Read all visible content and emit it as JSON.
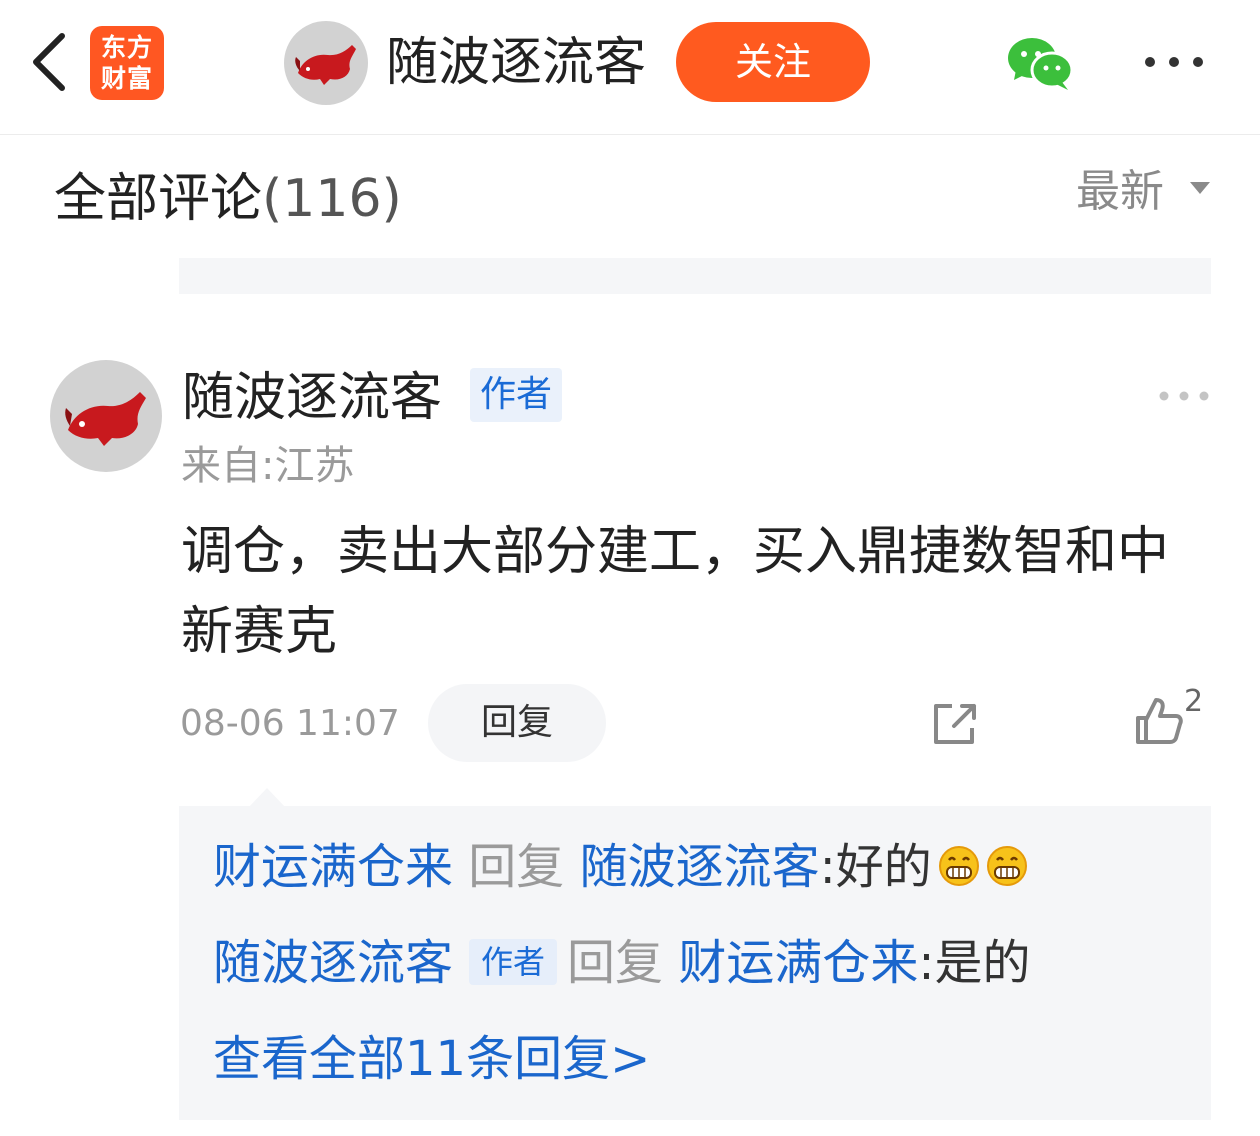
{
  "header": {
    "logo_line1": "东方",
    "logo_line2": "财富",
    "user_name": "随波逐流客",
    "follow_label": "关注"
  },
  "comments_section": {
    "title": "全部评论",
    "count": "(116)",
    "sort_label": "最新"
  },
  "comment": {
    "user_name": "随波逐流客",
    "author_tag": "作者",
    "location": "来自:江苏",
    "content": "调仓，卖出大部分建工，买入鼎捷数智和中新赛克",
    "timestamp": "08-06 11:07",
    "reply_label": "回复",
    "like_count": "2",
    "replies": [
      {
        "from": "财运满仓来",
        "verb": "回复",
        "to": "随波逐流客",
        "sep": ":",
        "text": "好的",
        "emoji": "grin-emoji"
      },
      {
        "from": "随波逐流客",
        "from_tag": "作者",
        "verb": "回复",
        "to": "财运满仓来",
        "sep": ":",
        "text": "是的"
      }
    ],
    "view_all": "查看全部11条回复>"
  },
  "colors": {
    "brand": "#ff5722",
    "follow": "#ff5a1f",
    "link": "#1a66cc"
  },
  "icons": [
    "back-arrow-icon",
    "wechat-icon",
    "more-icon",
    "dropdown-arrow-icon",
    "share-icon",
    "thumbs-up-icon"
  ]
}
